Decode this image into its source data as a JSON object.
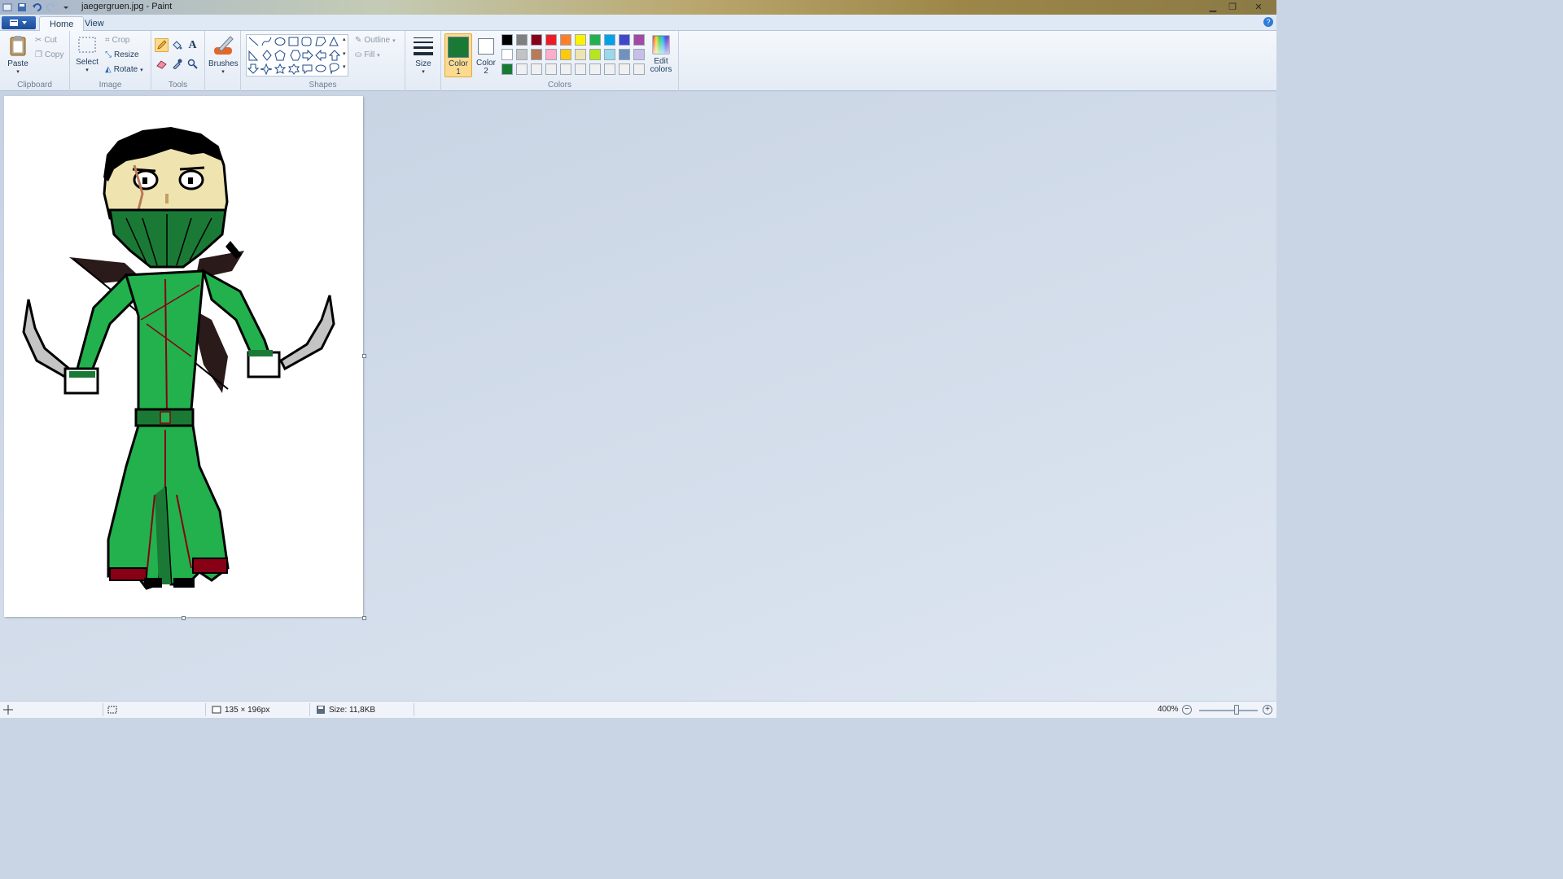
{
  "window": {
    "title": "jaegergruen.jpg - Paint"
  },
  "tabs": [
    {
      "label": "Home",
      "active": true
    },
    {
      "label": "View",
      "active": false
    }
  ],
  "ribbon": {
    "clipboard": {
      "group_label": "Clipboard",
      "paste": "Paste",
      "cut": "Cut",
      "copy": "Copy"
    },
    "image": {
      "group_label": "Image",
      "select": "Select",
      "crop": "Crop",
      "resize": "Resize",
      "rotate": "Rotate"
    },
    "tools": {
      "group_label": "Tools",
      "items": [
        "pencil-icon",
        "fill-bucket-icon",
        "text-icon",
        "eraser-icon",
        "color-picker-icon",
        "magnifier-icon"
      ]
    },
    "brushes": {
      "label": "Brushes"
    },
    "shapes": {
      "group_label": "Shapes",
      "outline": "Outline",
      "fill": "Fill"
    },
    "size": {
      "label": "Size"
    },
    "colors": {
      "group_label": "Colors",
      "color1_label": "Color",
      "color1_num": "1",
      "color2_label": "Color",
      "color2_num": "2",
      "color1_value": "#1a7a35",
      "color2_value": "#ffffff",
      "edit_label_1": "Edit",
      "edit_label_2": "colors",
      "palette_row1": [
        "#000000",
        "#7f7f7f",
        "#880015",
        "#ed1c24",
        "#ff7f27",
        "#fff200",
        "#22b14c",
        "#00a2e8",
        "#3f48cc",
        "#a349a4"
      ],
      "palette_row2": [
        "#ffffff",
        "#c3c3c3",
        "#b97a57",
        "#ffaec9",
        "#ffc90e",
        "#efe4b0",
        "#b5e61d",
        "#99d9ea",
        "#7092be",
        "#c8bfe7"
      ],
      "palette_row3": [
        "#1a7a35",
        "#f0f0f0",
        "#f0f0f0",
        "#f0f0f0",
        "#f0f0f0",
        "#f0f0f0",
        "#f0f0f0",
        "#f0f0f0",
        "#f0f0f0",
        "#f0f0f0"
      ]
    }
  },
  "status": {
    "dimensions": "135 × 196px",
    "size": "Size: 11,8KB",
    "zoom": "400%"
  }
}
